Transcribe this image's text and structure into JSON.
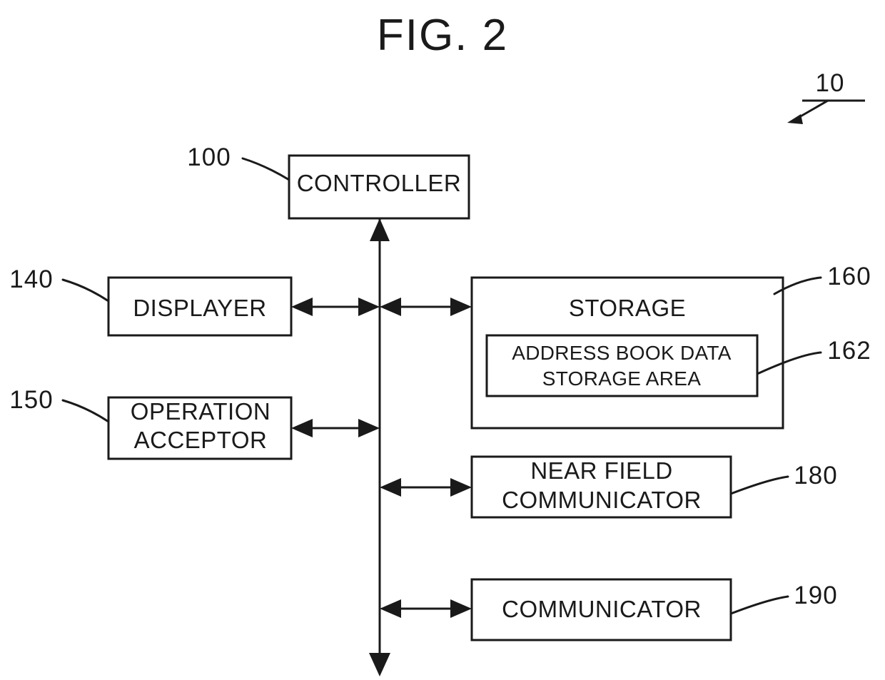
{
  "figure": {
    "title": "FIG. 2",
    "system_ref": "10"
  },
  "blocks": [
    {
      "id": "controller",
      "label": "CONTROLLER",
      "ref": "100"
    },
    {
      "id": "displayer",
      "label": "DISPLAYER",
      "ref": "140"
    },
    {
      "id": "operation-acceptor",
      "label_line1": "OPERATION",
      "label_line2": "ACCEPTOR",
      "ref": "150"
    },
    {
      "id": "storage",
      "label": "STORAGE",
      "ref": "160"
    },
    {
      "id": "address-book-data-storage-area",
      "label_line1": "ADDRESS BOOK DATA",
      "label_line2": "STORAGE AREA",
      "ref": "162"
    },
    {
      "id": "near-field-communicator",
      "label_line1": "NEAR FIELD",
      "label_line2": "COMMUNICATOR",
      "ref": "180"
    },
    {
      "id": "communicator",
      "label": "COMMUNICATOR",
      "ref": "190"
    }
  ],
  "colors": {
    "ink": "#1a1a1a",
    "background": "#ffffff"
  }
}
